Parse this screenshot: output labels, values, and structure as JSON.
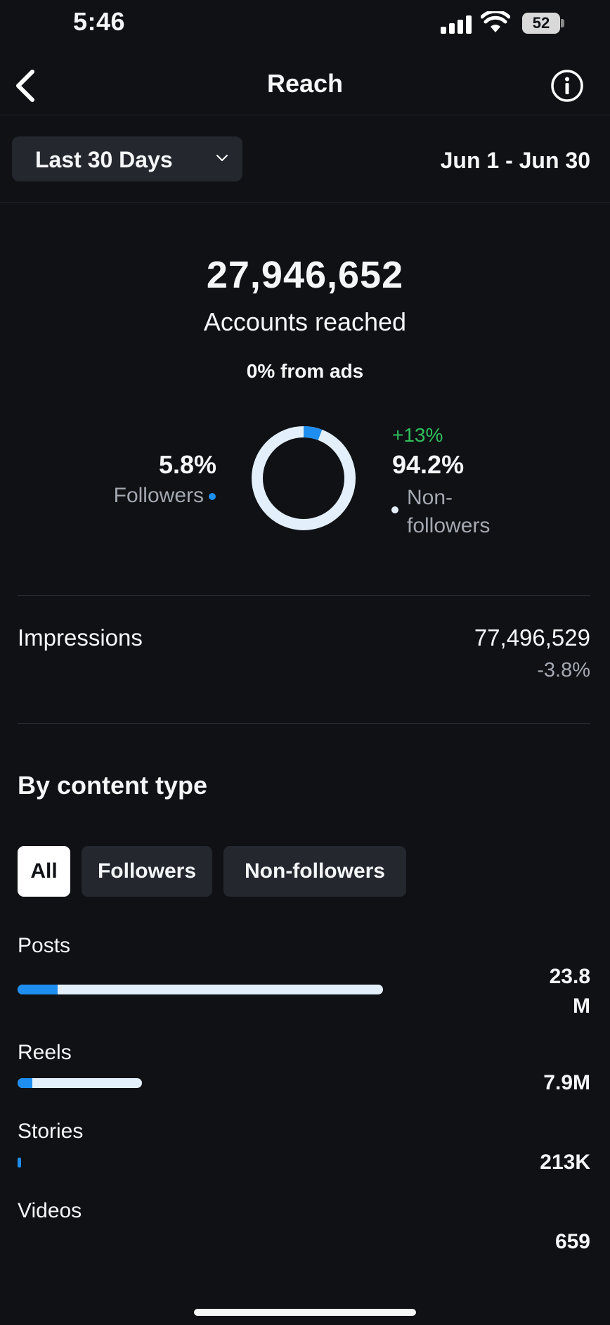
{
  "status_bar": {
    "time": "5:46",
    "battery": "52"
  },
  "header": {
    "title": "Reach"
  },
  "date_filter": {
    "selected": "Last 30 Days",
    "range": "Jun 1 - Jun 30"
  },
  "summary": {
    "accounts_reached": "27,946,652",
    "accounts_label": "Accounts reached",
    "ads_text": "0% from ads",
    "followers_pct": "5.8%",
    "followers_label": "Followers",
    "followers_fraction": 0.058,
    "nonfollowers_change": "+13%",
    "nonfollowers_pct": "94.2%",
    "nonfollowers_label": "Non-followers",
    "colors": {
      "followers": "#1f8ef1",
      "nonfollowers": "#e3f0fb",
      "positive": "#2fbf5b"
    }
  },
  "impressions": {
    "label": "Impressions",
    "value": "77,496,529",
    "change": "-3.8%"
  },
  "content_type": {
    "title": "By content type",
    "filters": [
      "All",
      "Followers",
      "Non-followers"
    ],
    "selected_filter": "All",
    "rows": [
      {
        "label": "Posts",
        "value": "23.8M",
        "value_line1": "23.8",
        "value_line2": "M",
        "total_fraction": 1.0,
        "followers_fraction": 0.11
      },
      {
        "label": "Reels",
        "value": "7.9M",
        "total_fraction": 0.34,
        "followers_fraction": 0.04
      },
      {
        "label": "Stories",
        "value": "213K",
        "total_fraction": 0.009,
        "followers_fraction": 0.009
      },
      {
        "label": "Videos",
        "value": "659",
        "total_fraction": 0,
        "followers_fraction": 0
      }
    ]
  }
}
